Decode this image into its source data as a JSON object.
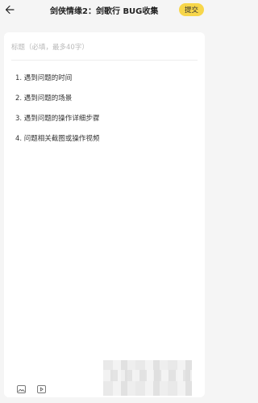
{
  "header": {
    "back_icon": "arrow-left-icon",
    "title": "剑侠情缘2：剑歌行 BUG收集",
    "submit_label": "提交"
  },
  "form": {
    "title_placeholder": "标题（必填，最多40字）",
    "title_value": "",
    "guide_items": [
      "1. 遇到问题的时间",
      "2. 遇到问题的场景",
      "3. 遇到问题的操作详细步骤",
      "4. 问题相关截图或操作视频"
    ]
  },
  "attachments": {
    "image_icon": "image-icon",
    "video_icon": "video-icon"
  },
  "colors": {
    "accent": "#f7d64a",
    "background": "#f5f5f5",
    "card": "#ffffff",
    "placeholder": "#b9b9b9"
  }
}
